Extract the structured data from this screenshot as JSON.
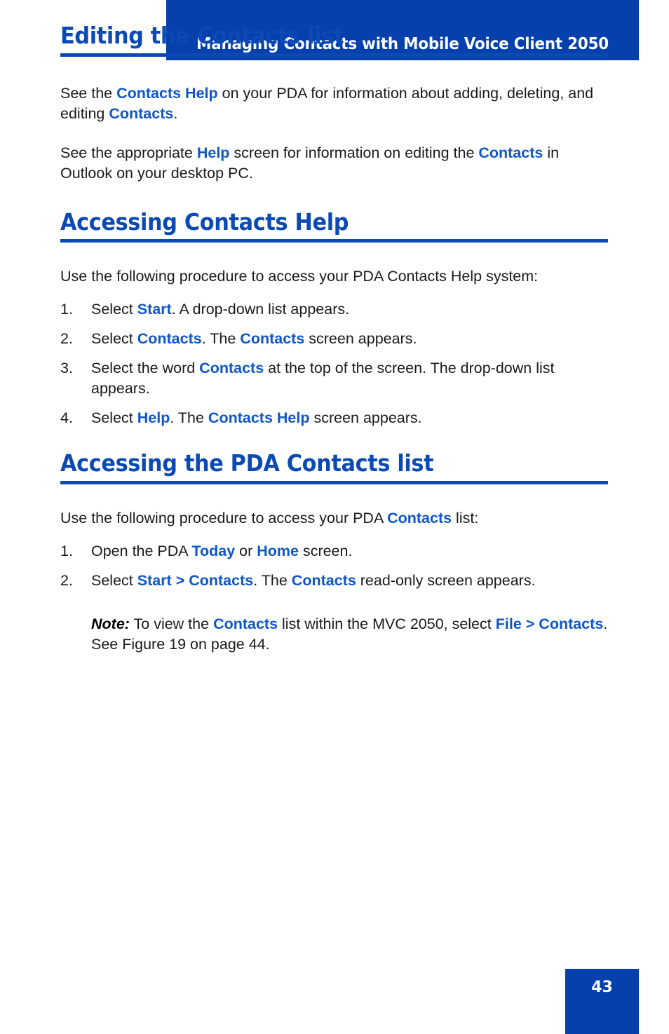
{
  "header": {
    "title": "Managing Contacts with Mobile Voice Client 2050",
    "bar_color": "#0540AC",
    "title_color": "#FFFFFF"
  },
  "colors": {
    "heading_blue": "#0B49B4",
    "emphasis_blue": "#0F56C8",
    "body_black": "#1A1A1A"
  },
  "sections": [
    {
      "heading": "Editing the Contacts list",
      "paragraphs": [
        {
          "runs": [
            {
              "text": "See the ",
              "style": "plain"
            },
            {
              "text": "Contacts Help",
              "style": "ui"
            },
            {
              "text": " on your PDA for information about adding, deleting, and editing ",
              "style": "plain"
            },
            {
              "text": "Contacts",
              "style": "ui"
            },
            {
              "text": ".",
              "style": "plain"
            }
          ]
        },
        {
          "runs": [
            {
              "text": "See the appropriate ",
              "style": "plain"
            },
            {
              "text": "Help",
              "style": "ui"
            },
            {
              "text": " screen for information on editing the ",
              "style": "plain"
            },
            {
              "text": "Contacts",
              "style": "ui"
            },
            {
              "text": " in Outlook on your desktop PC.",
              "style": "plain"
            }
          ]
        }
      ],
      "steps": []
    },
    {
      "heading": "Accessing Contacts Help",
      "paragraphs": [
        {
          "runs": [
            {
              "text": "Use the following procedure to access your PDA Contacts Help system:",
              "style": "plain"
            }
          ]
        }
      ],
      "steps": [
        {
          "number": "1.",
          "runs": [
            {
              "text": "Select ",
              "style": "plain"
            },
            {
              "text": "Start",
              "style": "ui"
            },
            {
              "text": ". A drop-down list appears.",
              "style": "plain"
            }
          ]
        },
        {
          "number": "2.",
          "runs": [
            {
              "text": "Select ",
              "style": "plain"
            },
            {
              "text": "Contacts",
              "style": "ui"
            },
            {
              "text": ". The ",
              "style": "plain"
            },
            {
              "text": "Contacts",
              "style": "ui"
            },
            {
              "text": " screen appears.",
              "style": "plain"
            }
          ]
        },
        {
          "number": "3.",
          "runs": [
            {
              "text": "Select the word ",
              "style": "plain"
            },
            {
              "text": "Contacts",
              "style": "ui"
            },
            {
              "text": " at the top of the screen. The drop-down list appears.",
              "style": "plain"
            }
          ]
        },
        {
          "number": "4.",
          "runs": [
            {
              "text": "Select ",
              "style": "plain"
            },
            {
              "text": "Help",
              "style": "ui"
            },
            {
              "text": ". The ",
              "style": "plain"
            },
            {
              "text": "Contacts Help",
              "style": "ui"
            },
            {
              "text": " screen appears.",
              "style": "plain"
            }
          ]
        }
      ]
    },
    {
      "heading": "Accessing the PDA Contacts list",
      "paragraphs": [
        {
          "runs": [
            {
              "text": "Use the following procedure to access your PDA ",
              "style": "plain"
            },
            {
              "text": "Contacts",
              "style": "ui"
            },
            {
              "text": " list:",
              "style": "plain"
            }
          ]
        }
      ],
      "steps": [
        {
          "number": "1.",
          "runs": [
            {
              "text": "Open the PDA ",
              "style": "plain"
            },
            {
              "text": "Today",
              "style": "ui"
            },
            {
              "text": " or ",
              "style": "plain"
            },
            {
              "text": "Home",
              "style": "ui"
            },
            {
              "text": " screen.",
              "style": "plain"
            }
          ]
        },
        {
          "number": "2.",
          "runs": [
            {
              "text": "Select ",
              "style": "plain"
            },
            {
              "text": "Start > Contacts",
              "style": "ui"
            },
            {
              "text": ". The ",
              "style": "plain"
            },
            {
              "text": "Contacts",
              "style": "ui"
            },
            {
              "text": " read-only screen appears.",
              "style": "plain"
            }
          ]
        }
      ],
      "note": {
        "runs": [
          {
            "text": "Note:",
            "style": "note-label"
          },
          {
            "text": " To view the ",
            "style": "plain"
          },
          {
            "text": "Contacts",
            "style": "ui"
          },
          {
            "text": " list within the MVC 2050, select ",
            "style": "plain"
          },
          {
            "text": "File > Contacts",
            "style": "ui"
          },
          {
            "text": ". See Figure 19 on page 44.",
            "style": "plain"
          }
        ]
      }
    }
  ],
  "footer": {
    "page_number": "43",
    "tab_color": "#0540AC"
  }
}
